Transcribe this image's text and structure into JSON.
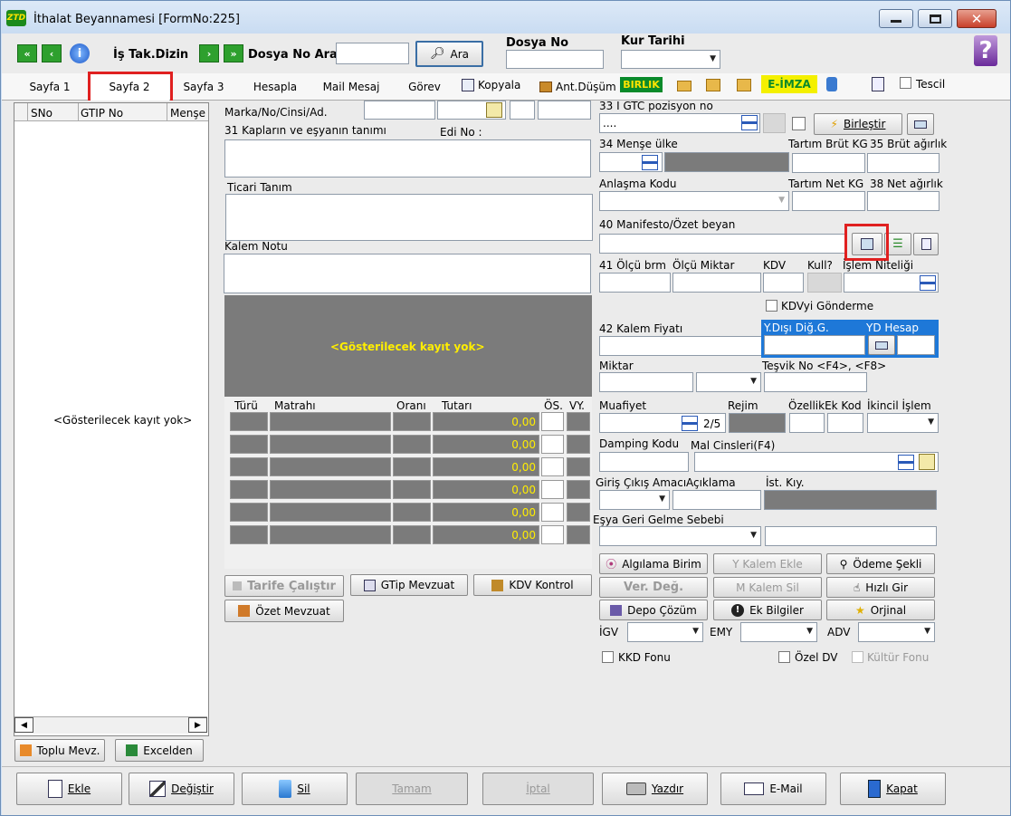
{
  "window": {
    "title": "İthalat Beyannamesi [FormNo:225]",
    "logo": "ZTD"
  },
  "toolbar": {
    "is_tak": "İş Tak.Dizin",
    "dosya_ara": "Dosya No Ara",
    "ara": "Ara",
    "dosya_no": "Dosya No",
    "kur_tarihi": "Kur Tarihi",
    "help": "?"
  },
  "tabs": [
    "Sayfa 1",
    "Sayfa 2",
    "Sayfa 3",
    "Hesapla",
    "Mail Mesaj",
    "Görev"
  ],
  "tabbar": {
    "kopyala": "Kopyala",
    "ant_dusum": "Ant.Düşüm",
    "birlik": "BIRLIK",
    "eimza": "E-İMZA",
    "tescil": "Tescil"
  },
  "left_grid": {
    "columns": [
      "SNo",
      "GTIP No",
      "Menşe"
    ],
    "empty": "<Gösterilecek kayıt yok>",
    "toplu": "Toplu Mevz.",
    "excel": "Excelden"
  },
  "mid": {
    "marka": "Marka/No/Cinsi/Ad.",
    "kaplar": "31 Kapların ve eşyanın tanımı",
    "edi": "Edi No :",
    "ticari": "Ticari Tanım",
    "kalem_notu": "Kalem Notu",
    "empty": "<Gösterilecek kayıt yok>",
    "tax_cols": [
      "Türü",
      "Matrahı",
      "Oranı",
      "Tutarı",
      "ÖS.",
      "VY."
    ],
    "tax_values": [
      "0,00",
      "0,00",
      "0,00",
      "0,00",
      "0,00",
      "0,00"
    ],
    "tarife": "Tarife Çalıştır",
    "gtip_mevzuat": "GTip Mevzuat",
    "kdv_kontrol": "KDV Kontrol",
    "ozet_mevzuat": "Özet Mevzuat"
  },
  "right": {
    "gtc": "33 I GTC pozisyon no",
    "gtc_value": "....",
    "birlestir": "Birleştir",
    "mense": "34 Menşe ülke",
    "tartim_brut": "Tartım Brüt KG",
    "brut": "35 Brüt ağırlık",
    "anlasma": "Anlaşma Kodu",
    "tartim_net": "Tartım Net KG",
    "net": "38 Net ağırlık",
    "manifesto": "40 Manifesto/Özet beyan",
    "olcu_brm": "41 Ölçü brm",
    "olcu_miktar": "Ölçü Miktar",
    "kdv": "KDV",
    "kull": "Kull?",
    "islem": "İşlem Niteliği",
    "kdv_gonderme": "KDVyi Gönderme",
    "kalem_fiyati": "42 Kalem Fiyatı",
    "ydisi": "Y.Dışı Diğ.G.",
    "yd_hesap": "YD Hesap",
    "miktar": "Miktar",
    "tesvik": "Teşvik No <F4>, <F8>",
    "muafiyet": "Muafiyet",
    "muafiyet_count": "2/5",
    "rejim": "Rejim",
    "ozellik": "ÖzellikEk Kod",
    "ikincil": "İkincil İşlem",
    "damping": "Damping Kodu",
    "mal_cinsleri": "Mal Cinsleri(F4)",
    "giris": "Giriş Çıkış Amacı",
    "aciklama": "Açıklama",
    "ist_kiy": "İst. Kıy.",
    "esya_geri": "Eşya Geri Gelme Sebebi",
    "algilama": "Algılama Birim",
    "ykalem": "Y Kalem Ekle",
    "odeme": "Ödeme Şekli",
    "ver_deg": "Ver. Değ.",
    "mkalem": "M Kalem Sil",
    "hizli": "Hızlı Gir",
    "depo": "Depo Çözüm",
    "ek_bilgiler": "Ek Bilgiler",
    "orjinal": "Orjinal",
    "igv": "İGV",
    "emy": "EMY",
    "adv": "ADV",
    "kkd": "KKD Fonu",
    "ozel_dv": "Özel DV",
    "kultur": "Kültür Fonu"
  },
  "bottom": [
    "Ekle",
    "Değiştir",
    "Sil",
    "Tamam",
    "İptal",
    "Yazdır",
    "E-Mail",
    "Kapat"
  ]
}
